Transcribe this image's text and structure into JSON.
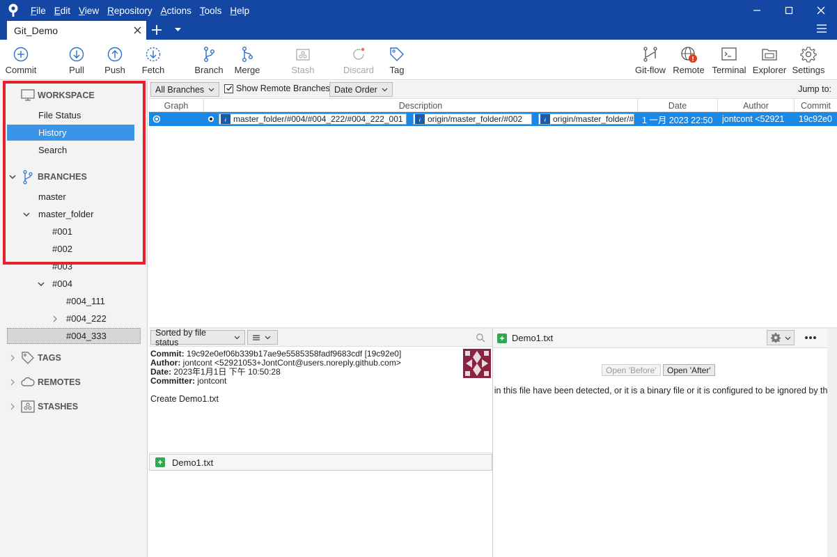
{
  "menu": {
    "items": [
      "File",
      "Edit",
      "View",
      "Repository",
      "Actions",
      "Tools",
      "Help"
    ]
  },
  "tab": {
    "title": "Git_Demo"
  },
  "toolbar": {
    "commit": "Commit",
    "pull": "Pull",
    "push": "Push",
    "fetch": "Fetch",
    "branch": "Branch",
    "merge": "Merge",
    "stash": "Stash",
    "discard": "Discard",
    "tag": "Tag",
    "gitflow": "Git-flow",
    "remote": "Remote",
    "terminal": "Terminal",
    "explorer": "Explorer",
    "settings": "Settings",
    "remote_badge": "!"
  },
  "sidebar": {
    "workspace": "WORKSPACE",
    "file_status": "File Status",
    "history": "History",
    "search": "Search",
    "branches": "BRANCHES",
    "branch_items": {
      "master": "master",
      "master_folder": "master_folder",
      "b001": "#001",
      "b002": "#002",
      "b003": "#003",
      "b004": "#004",
      "b004_111": "#004_111",
      "b004_222": "#004_222",
      "b004_333": "#004_333"
    },
    "tags": "TAGS",
    "remotes": "REMOTES",
    "stashes": "STASHES"
  },
  "history": {
    "branch_filter": "All Branches",
    "show_remote_label": "Show Remote Branches",
    "show_remote_checked": true,
    "order": "Date Order",
    "jump_to": "Jump to:",
    "columns": {
      "graph": "Graph",
      "description": "Description",
      "date": "Date",
      "author": "Author",
      "commit": "Commit"
    },
    "row": {
      "ref1": "master_folder/#004/#004_222/#004_222_001",
      "ref2": "origin/master_folder/#002",
      "ref3": "origin/master_folder/#",
      "date": "1 一月 2023 22:50",
      "author": "jontcont <52921",
      "commit": "19c92e0"
    }
  },
  "files": {
    "sort": "Sorted by file status",
    "file": "Demo1.txt"
  },
  "details": {
    "commit_label": "Commit:",
    "commit_value": "19c92e0ef06b339b17ae9e5585358fadf9683cdf [19c92e0]",
    "author_label": "Author:",
    "author_value": "jontcont <52921053+JontCont@users.noreply.github.com>",
    "date_label": "Date:",
    "date_value": "2023年1月1日 下午 10:50:28",
    "committer_label": "Committer:",
    "committer_value": "jontcont",
    "message": "Create Demo1.txt"
  },
  "diff": {
    "file": "Demo1.txt",
    "open_before": "Open 'Before'",
    "open_after": "Open 'After'",
    "message": "s in this file have been detected, or it is a binary file or it is configured to be ignored by the F"
  },
  "colors": {
    "title_bar": "#1447a3",
    "selection": "#1c88e6",
    "history_selected": "#3a95e8",
    "highlight_box": "#e8202a"
  }
}
